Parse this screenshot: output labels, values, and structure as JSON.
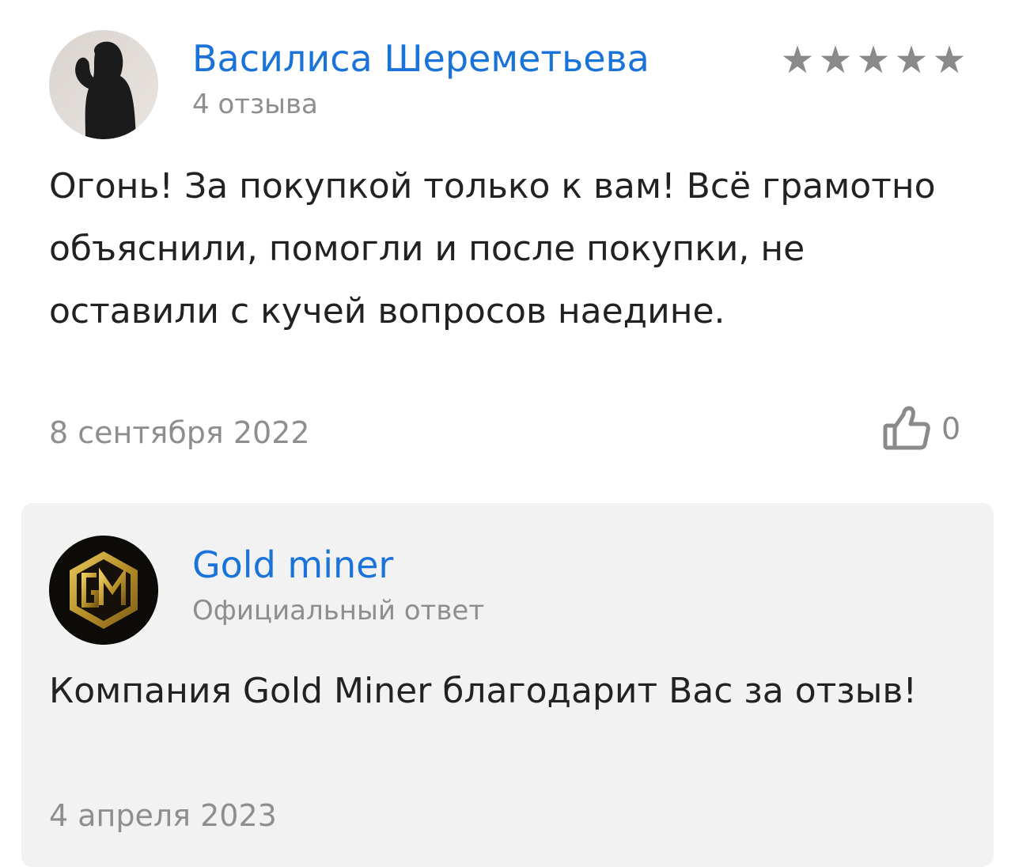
{
  "review": {
    "author_name": "Василиса Шереметьева",
    "author_reviews_count": "4 отзыва",
    "rating": 5,
    "text": "Огонь! За покупкой только к вам! Всё грамотно объяснили, помогли и после покупки, не оставили с кучей вопросов наедине.",
    "date": "8 сентября 2022",
    "likes": "0",
    "avatar_icon": "user-photo-silhouette",
    "like_icon": "thumbs-up-icon"
  },
  "reply": {
    "company_name": "Gold miner",
    "label": "Официальный ответ",
    "text": "Компания Gold Miner благодарит Вас за отзыв!",
    "date": "4 апреля 2023",
    "logo_icon": "gold-miner-logo"
  },
  "colors": {
    "link": "#1a73d9",
    "muted_text": "#8e8e8e",
    "body_text": "#222222",
    "reply_background": "#f2f2f2",
    "star": "#8a8a8a",
    "gold": "#c9a227"
  }
}
